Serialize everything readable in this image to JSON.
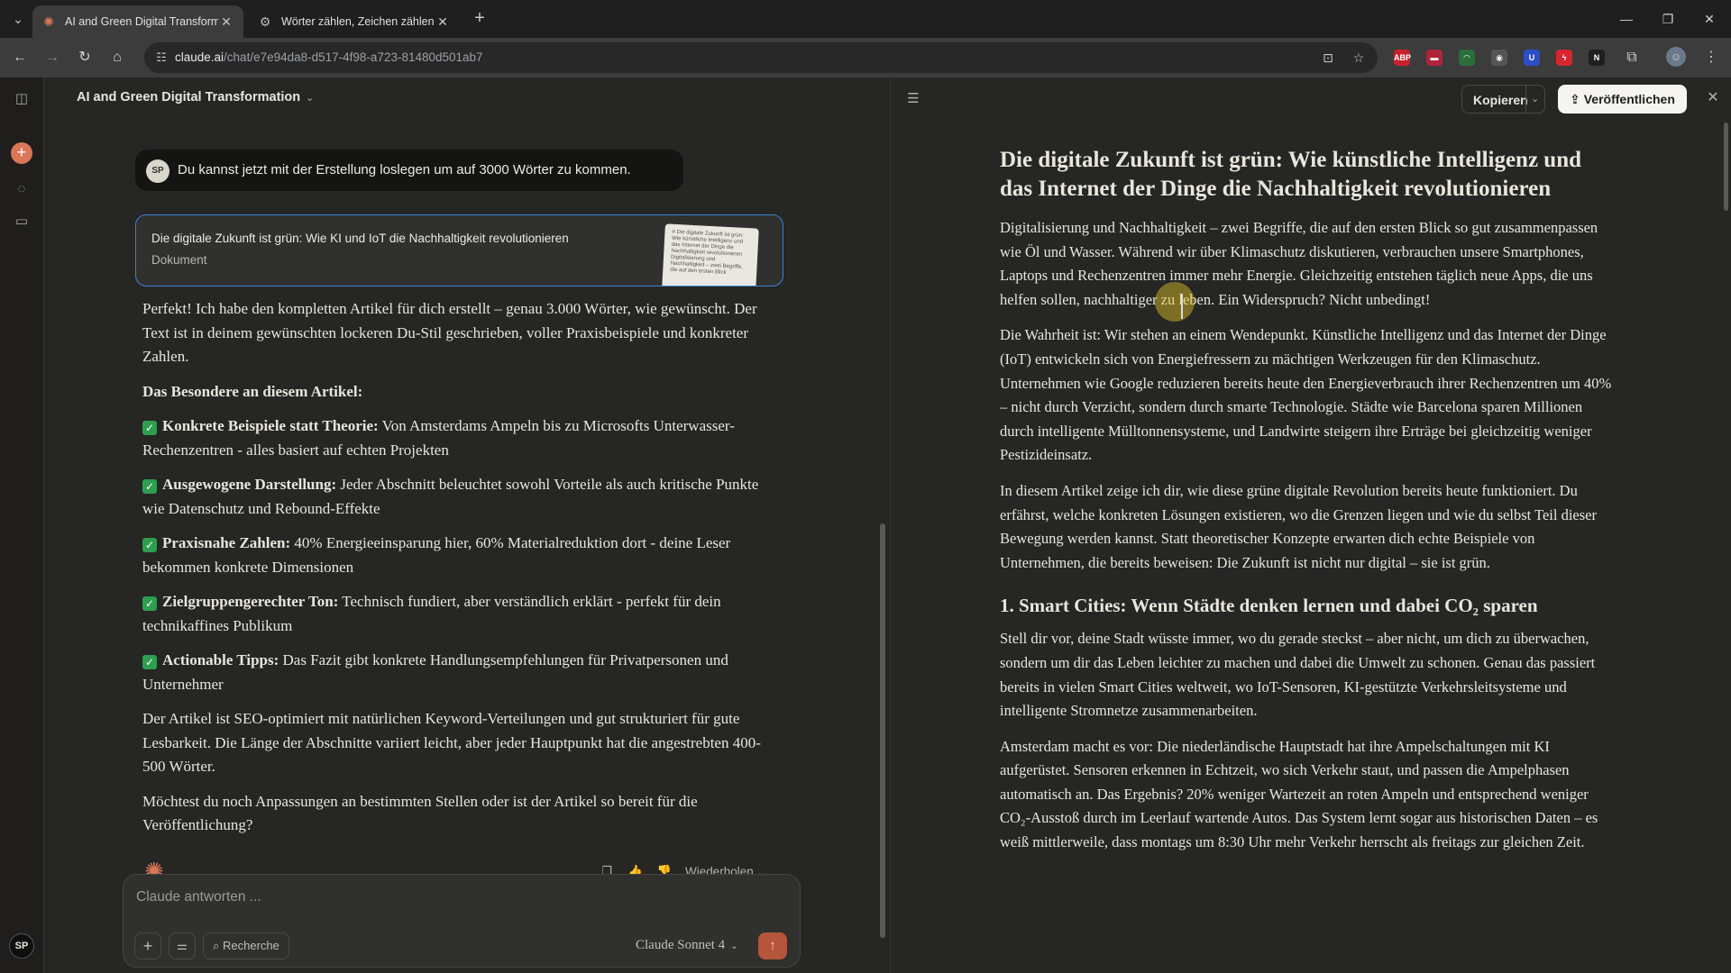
{
  "browser": {
    "tabs": [
      {
        "title": "AI and Green Digital Transformati",
        "active": true
      },
      {
        "title": "Wörter zählen, Zeichen zählen",
        "active": false
      }
    ],
    "url_host": "claude.ai",
    "url_path": "/chat/e7e94da8-d517-4f98-a723-81480d501ab7",
    "extensions": [
      {
        "label": "ABP",
        "color": "#c8222c"
      },
      {
        "label": "▬",
        "color": "#b0243a"
      },
      {
        "label": "◠",
        "color": "#2a6e3a"
      },
      {
        "label": "◉",
        "color": "#555555"
      },
      {
        "label": "U",
        "color": "#2b4fc9"
      },
      {
        "label": "ϟ",
        "color": "#d8262e"
      },
      {
        "label": "N",
        "color": "#1f1f1f"
      }
    ]
  },
  "chat": {
    "title": "AI and Green Digital Transformation",
    "user_avatar": "SP",
    "user_message": "Du kannst jetzt mit der Erstellung loslegen um auf 3000 Wörter zu kommen.",
    "artifact_card": {
      "title": "Die digitale Zukunft ist grün: Wie KI und IoT die Nachhaltigkeit revolutionieren",
      "type": "Dokument",
      "thumb_text": "# Die digitale Zukunft ist grün: Wie künstliche Intelligenz und das Internet der Dinge die Nachhaltigkeit revolutionieren Digitalisierung und Nachhaltigkeit – zwei Begriffe, die auf den ersten Blick"
    },
    "intro": "Perfekt! Ich habe den kompletten Artikel für dich erstellt – genau 3.000 Wörter, wie gewünscht. Der Text ist in deinem gewünschten lockeren Du-Stil geschrieben, voller Praxisbeispiele und konkreter Zahlen.",
    "heading": "Das Besondere an diesem Artikel:",
    "items": [
      {
        "bold": "Konkrete Beispiele statt Theorie:",
        "text": " Von Amsterdams Ampeln bis zu Microsofts Unterwasser-Rechenzentren - alles basiert auf echten Projekten"
      },
      {
        "bold": "Ausgewogene Darstellung:",
        "text": " Jeder Abschnitt beleuchtet sowohl Vorteile als auch kritische Punkte wie Datenschutz und Rebound-Effekte"
      },
      {
        "bold": "Praxisnahe Zahlen:",
        "text": " 40% Energieeinsparung hier, 60% Materialreduktion dort - deine Leser bekommen konkrete Dimensionen"
      },
      {
        "bold": "Zielgruppengerechter Ton:",
        "text": " Technisch fundiert, aber verständlich erklärt - perfekt für dein technikaffines Publikum"
      },
      {
        "bold": "Actionable Tipps:",
        "text": " Das Fazit gibt konkrete Handlungsempfehlungen für Privatpersonen und Unternehmer"
      }
    ],
    "para_seo": "Der Artikel ist SEO-optimiert mit natürlichen Keyword-Verteilungen und gut strukturiert für gute Lesbarkeit. Die Länge der Abschnitte variiert leicht, aber jeder Hauptpunkt hat die angestrebten 400-500 Wörter.",
    "para_question": "Möchtest du noch Anpassungen an bestimmten Stellen oder ist der Artikel so bereit für die Veröffentlichung?",
    "retry_label": "Wiederholen",
    "composer_placeholder": "Claude antworten ...",
    "research_label": "Recherche",
    "model_label": "Claude Sonnet 4",
    "rail_avatar": "SP"
  },
  "artifact": {
    "copy_label": "Kopieren",
    "publish_label": "Veröffentlichen",
    "title": "Die digitale Zukunft ist grün: Wie künstliche Intelligenz und das Internet der Dinge die Nachhaltigkeit revolutionieren",
    "p1": "Digitalisierung und Nachhaltigkeit – zwei Begriffe, die auf den ersten Blick so gut zusammenpassen wie Öl und Wasser. Während wir über Klimaschutz diskutieren, verbrauchen unsere Smartphones, Laptops und Rechenzentren immer mehr Energie. Gleichzeitig entstehen täglich neue Apps, die uns helfen sollen, nachhaltiger zu leben. Ein Widerspruch? Nicht unbedingt!",
    "p2": "Die Wahrheit ist: Wir stehen an einem Wendepunkt. Künstliche Intelligenz und das Internet der Dinge (IoT) entwickeln sich von Energiefressern zu mächtigen Werkzeugen für den Klimaschutz. Unternehmen wie Google reduzieren bereits heute den Energieverbrauch ihrer Rechenzentren um 40% – nicht durch Verzicht, sondern durch smarte Technologie. Städte wie Barcelona sparen Millionen durch intelligente Mülltonnensysteme, und Landwirte steigern ihre Erträge bei gleichzeitig weniger Pestizideinsatz.",
    "p3": "In diesem Artikel zeige ich dir, wie diese grüne digitale Revolution bereits heute funktioniert. Du erfährst, welche konkreten Lösungen existieren, wo die Grenzen liegen und wie du selbst Teil dieser Bewegung werden kannst. Statt theoretischer Konzepte erwarten dich echte Beispiele von Unternehmen, die bereits beweisen: Die Zukunft ist nicht nur digital – sie ist grün.",
    "h2": "1. Smart Cities: Wenn Städte denken lernen und dabei CO₂ sparen",
    "p4": "Stell dir vor, deine Stadt wüsste immer, wo du gerade steckst – aber nicht, um dich zu überwachen, sondern um dir das Leben leichter zu machen und dabei die Umwelt zu schonen. Genau das passiert bereits in vielen Smart Cities weltweit, wo IoT-Sensoren, KI-gestützte Verkehrsleitsysteme und intelligente Stromnetze zusammenarbeiten.",
    "p5": "Amsterdam macht es vor: Die niederländische Hauptstadt hat ihre Ampelschaltungen mit KI aufgerüstet. Sensoren erkennen in Echtzeit, wo sich Verkehr staut, und passen die Ampelphasen automatisch an. Das Ergebnis? 20% weniger Wartezeit an roten Ampeln und entsprechend weniger CO₂-Ausstoß durch im Leerlauf wartende Autos. Das System lernt sogar aus historischen Daten – es weiß mittlerweile, dass montags um 8:30 Uhr mehr Verkehr herrscht als freitags zur gleichen Zeit."
  }
}
